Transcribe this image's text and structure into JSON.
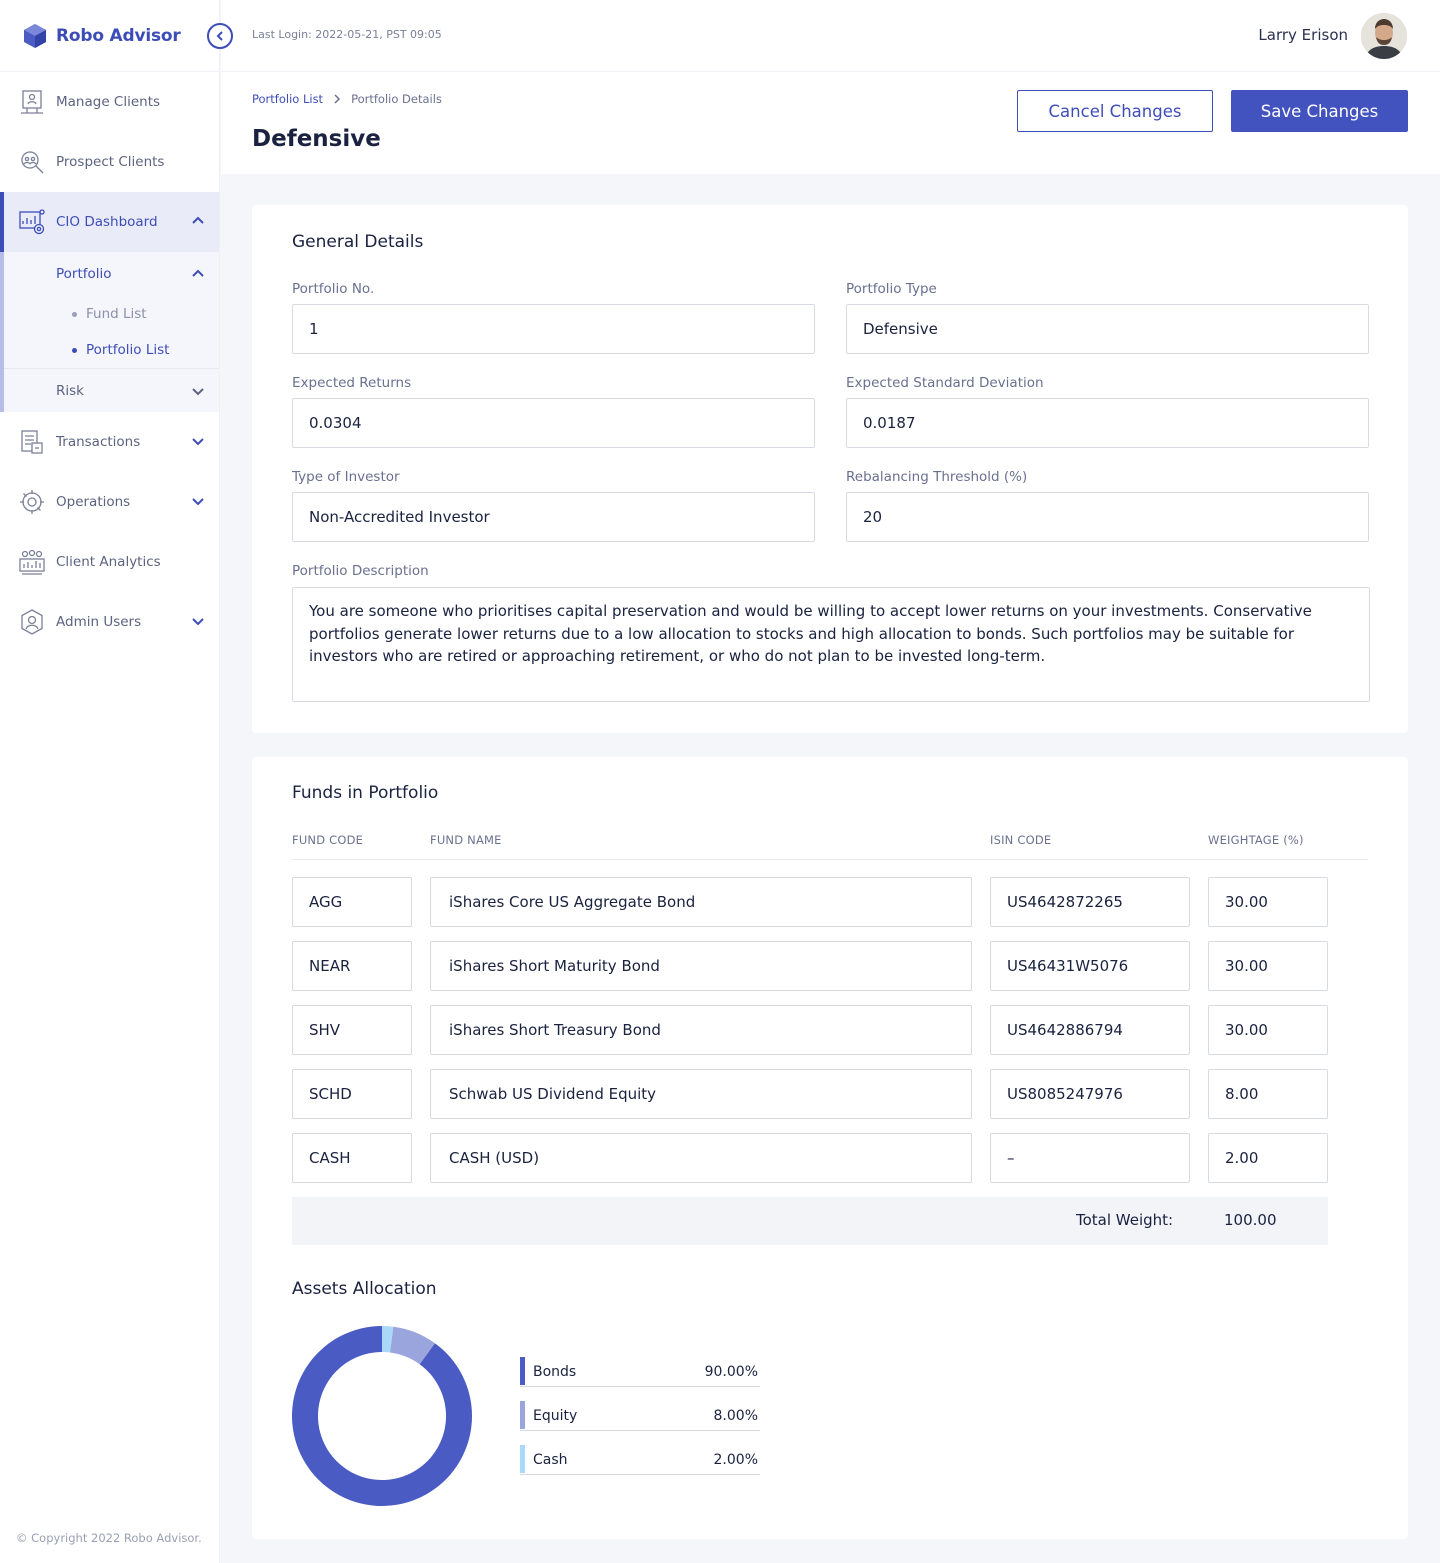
{
  "app": {
    "name": "Robo Advisor"
  },
  "topbar": {
    "last_login": "Last Login: 2022-05-21, PST 09:05",
    "user_name": "Larry Erison"
  },
  "sidebar": {
    "items": [
      {
        "label": "Manage Clients",
        "icon": "manage-clients-icon"
      },
      {
        "label": "Prospect Clients",
        "icon": "prospect-clients-icon"
      },
      {
        "label": "CIO Dashboard",
        "icon": "cio-dashboard-icon"
      },
      {
        "label": "Transactions",
        "icon": "transactions-icon"
      },
      {
        "label": "Operations",
        "icon": "operations-icon"
      },
      {
        "label": "Client Analytics",
        "icon": "client-analytics-icon"
      },
      {
        "label": "Admin Users",
        "icon": "admin-users-icon"
      }
    ],
    "submenu": {
      "portfolio": "Portfolio",
      "fund_list": "Fund List",
      "portfolio_list": "Portfolio List",
      "risk": "Risk"
    },
    "copyright": "© Copyright 2022 Robo Advisor."
  },
  "header": {
    "breadcrumb": {
      "parent": "Portfolio List",
      "current": "Portfolio Details"
    },
    "title": "Defensive",
    "cancel_label": "Cancel Changes",
    "save_label": "Save Changes"
  },
  "general": {
    "title": "General Details",
    "portfolio_no_label": "Portfolio No.",
    "portfolio_no": "1",
    "portfolio_type_label": "Portfolio Type",
    "portfolio_type": "Defensive",
    "expected_returns_label": "Expected Returns",
    "expected_returns": "0.0304",
    "expected_sd_label": "Expected Standard Deviation",
    "expected_sd": "0.0187",
    "investor_type_label": "Type of Investor",
    "investor_type": "Non-Accredited Investor",
    "rebalancing_label": "Rebalancing Threshold (%)",
    "rebalancing": "20",
    "description_label": "Portfolio Description",
    "description": "You are someone who prioritises capital preservation and would be willing to accept lower returns on your investments. Conservative portfolios generate lower returns due to a low allocation to stocks and high allocation to bonds. Such portfolios may be suitable for investors who are retired or approaching retirement, or who do not plan to be invested long-term."
  },
  "funds": {
    "title": "Funds in Portfolio",
    "columns": [
      "FUND CODE",
      "FUND NAME",
      "ISIN CODE",
      "WEIGHTAGE (%)"
    ],
    "rows": [
      {
        "code": "AGG",
        "name": "iShares Core US Aggregate Bond",
        "isin": "US4642872265",
        "weight": "30.00"
      },
      {
        "code": "NEAR",
        "name": "iShares Short Maturity Bond",
        "isin": "US46431W5076",
        "weight": "30.00"
      },
      {
        "code": "SHV",
        "name": "iShares Short Treasury Bond",
        "isin": "US4642886794",
        "weight": "30.00"
      },
      {
        "code": "SCHD",
        "name": "Schwab US Dividend Equity",
        "isin": "US8085247976",
        "weight": "8.00"
      },
      {
        "code": "CASH",
        "name": "CASH (USD)",
        "isin": "–",
        "weight": "2.00"
      }
    ],
    "total_label": "Total Weight:",
    "total_value": "100.00"
  },
  "assets": {
    "title": "Assets Allocation",
    "colors": {
      "bonds": "#4a5bc4",
      "equity": "#9aa4dd",
      "cash": "#a9d8f8"
    }
  },
  "chart_data": {
    "type": "pie",
    "title": "Assets Allocation",
    "categories": [
      "Bonds",
      "Equity",
      "Cash"
    ],
    "values": [
      90,
      8,
      2
    ],
    "labels": [
      "90.00%",
      "8.00%",
      "2.00%"
    ],
    "legend": "right"
  }
}
